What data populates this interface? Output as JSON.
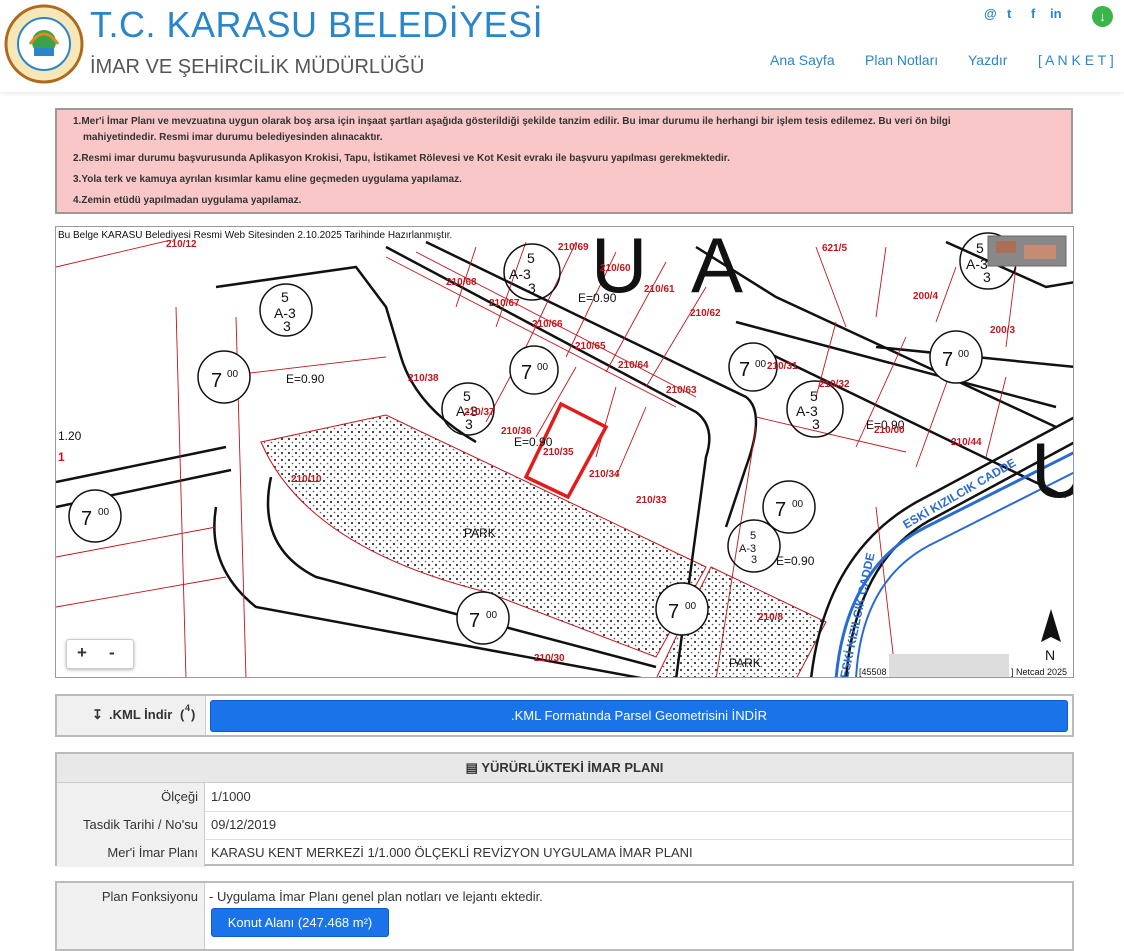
{
  "header": {
    "title": "T.C. KARASU BELEDİYESİ",
    "subtitle": "İMAR VE ŞEHİRCİLİK MÜDÜRLÜĞÜ",
    "logo_text": "KARASU BELEDİYESİ",
    "social": {
      "email": "@",
      "twitter": "t",
      "facebook": "f",
      "linkedin": "in"
    },
    "nav": [
      "Ana Sayfa",
      "Plan Notları",
      "Yazdır",
      "[ A N K E T ]"
    ]
  },
  "notes": [
    "1.Mer'i İmar Planı ve mevzuatına uygun olarak boş arsa için inşaat şartları aşağıda gösterildiği şekilde tanzim edilir. Bu imar durumu ile herhangi bir işlem tesis edilemez. Bu veri ön bilgi",
    "mahiyetindedir. Resmi imar durumu belediyesinden alınacaktır.",
    "2.Resmi imar durumu başvurusunda Aplikasyon Krokisi, Tapu, İstikamet Rölevesi ve Kot Kesit evrakı ile başvuru yapılması gerekmektedir.",
    "3.Yola terk ve kamuya ayrılan kısımlar kamu eline geçmeden uygulama yapılamaz.",
    "4.Zemin etüdü yapılmadan uygulama yapılamaz."
  ],
  "map": {
    "banner": "Bu Belge KARASU Belediyesi Resmi Web Sitesinden 2.10.2025 Tarihinde Hazırlanmıştır.",
    "attribution_prefix": "[45508",
    "attribution_suffix": "] Netcad 2025",
    "north": "N",
    "zoom_in": "+",
    "zoom_out": "-",
    "street_1": "ESKİ KIZILCIK CADDE",
    "street_2": "ESKİ KIZILCIK CADDE",
    "park_1": "PARK",
    "park_2": "PARK",
    "zone_a3": "A-3",
    "zone_5": "5",
    "zone_3": "3",
    "height_7": "7",
    "height_00": "00",
    "density_labels": [
      "E=0.90",
      "E=0.90",
      "E=0.90",
      "E=0.90",
      "E=0.90"
    ],
    "left_edge": [
      "1.20",
      "1"
    ],
    "big_letters": [
      "U",
      "A",
      "U"
    ],
    "parcels": [
      "210/36",
      "210/35",
      "210/34",
      "210/33",
      "210/37",
      "210/38",
      "210/10",
      "210/30",
      "210/64",
      "210/63",
      "210/65",
      "210/66",
      "210/67",
      "210/68",
      "210/69",
      "210/60",
      "210/61",
      "210/62",
      "210/31",
      "210/32",
      "210/00",
      "210/44",
      "210/12",
      "621/5",
      "200/4",
      "200/3",
      "210/8"
    ]
  },
  "kml": {
    "label": ".KML İndir",
    "sup": "4",
    "button": ".KML Formatında Parsel Geometrisini İNDİR"
  },
  "plan": {
    "heading": "YÜRÜRLÜKTEKİ İMAR PLANI",
    "rows": [
      {
        "key": "Ölçeği",
        "value": "1/1000"
      },
      {
        "key": "Tasdik Tarihi / No'su",
        "value": "09/12/2019"
      },
      {
        "key": "Mer'i İmar Planı",
        "value": "KARASU KENT MERKEZİ 1/1.000 ÖLÇEKLİ REVİZYON UYGULAMA İMAR PLANI"
      }
    ]
  },
  "function": {
    "key": "Plan Fonksiyonu",
    "value": "- Uygulama İmar Planı genel plan notları ve lejantı ektedir.",
    "button": "Konut Alanı (247.468 m²)"
  },
  "colors": {
    "accent": "#2a86c8",
    "note_bg": "#f9c7c7",
    "button": "#1a73e8",
    "parcel_red": "#c0171c"
  }
}
